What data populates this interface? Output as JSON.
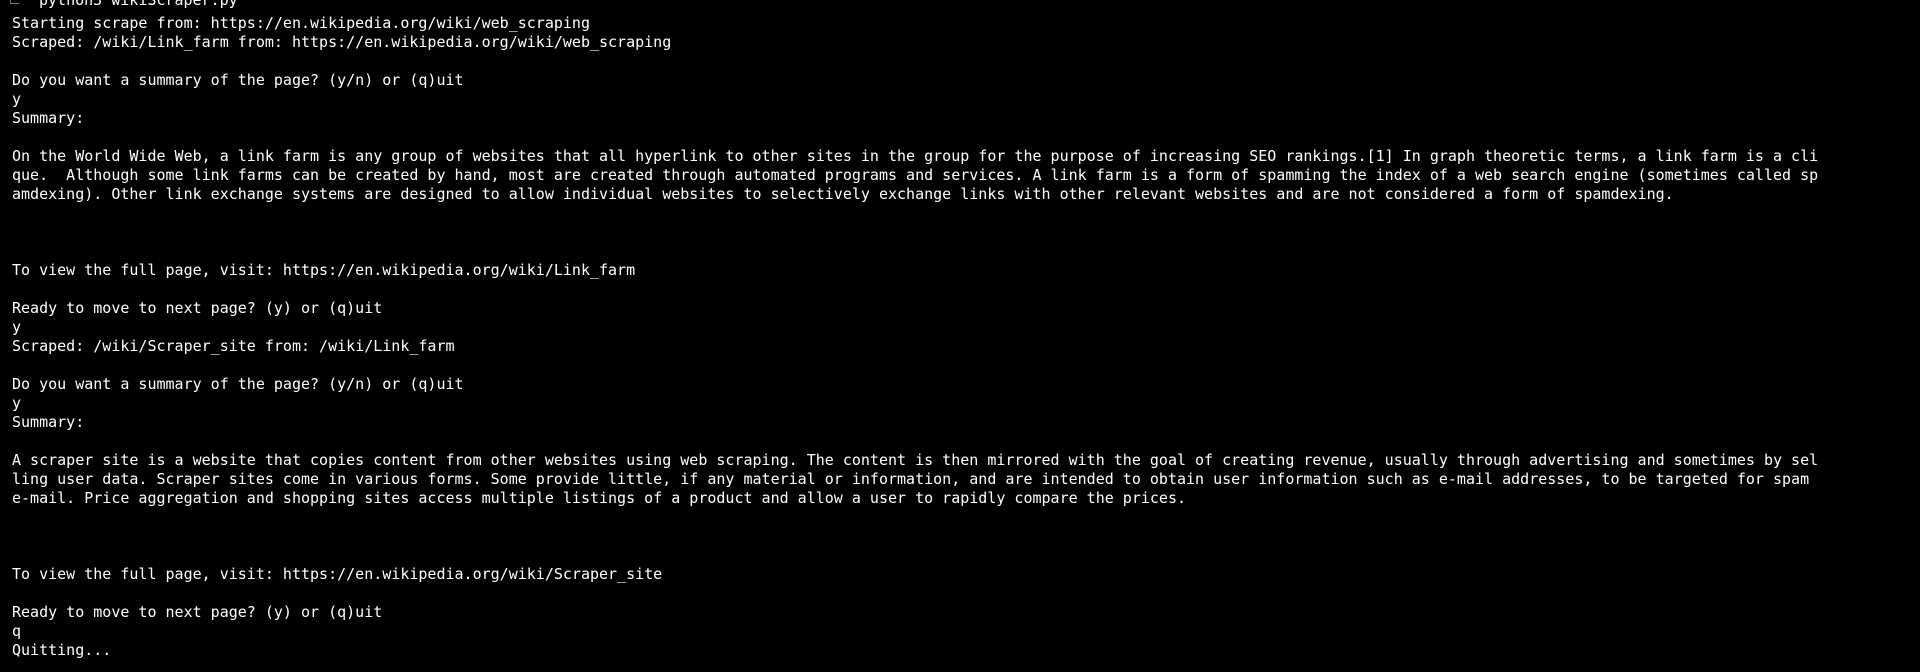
{
  "command": "python3 wikiScraper.py",
  "lines": [
    "Starting scrape from: https://en.wikipedia.org/wiki/web_scraping",
    "Scraped: /wiki/Link_farm from: https://en.wikipedia.org/wiki/web_scraping",
    "",
    "Do you want a summary of the page? (y/n) or (q)uit",
    "y",
    "Summary:",
    "",
    "On the World Wide Web, a link farm is any group of websites that all hyperlink to other sites in the group for the purpose of increasing SEO rankings.[1] In graph theoretic terms, a link farm is a cli",
    "que.  Although some link farms can be created by hand, most are created through automated programs and services. A link farm is a form of spamming the index of a web search engine (sometimes called sp",
    "amdexing). Other link exchange systems are designed to allow individual websites to selectively exchange links with other relevant websites and are not considered a form of spamdexing.",
    "",
    "",
    "",
    "To view the full page, visit: https://en.wikipedia.org/wiki/Link_farm",
    "",
    "Ready to move to next page? (y) or (q)uit",
    "y",
    "Scraped: /wiki/Scraper_site from: /wiki/Link_farm",
    "",
    "Do you want a summary of the page? (y/n) or (q)uit",
    "y",
    "Summary:",
    "",
    "A scraper site is a website that copies content from other websites using web scraping. The content is then mirrored with the goal of creating revenue, usually through advertising and sometimes by sel",
    "ling user data. Scraper sites come in various forms. Some provide little, if any material or information, and are intended to obtain user information such as e-mail addresses, to be targeted for spam",
    "e-mail. Price aggregation and shopping sites access multiple listings of a product and allow a user to rapidly compare the prices.",
    "",
    "",
    "",
    "To view the full page, visit: https://en.wikipedia.org/wiki/Scraper_site",
    "",
    "Ready to move to next page? (y) or (q)uit",
    "q",
    "Quitting..."
  ]
}
